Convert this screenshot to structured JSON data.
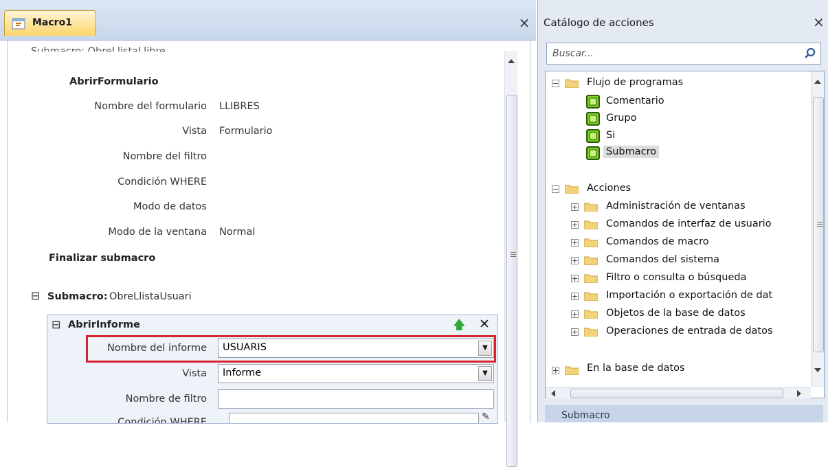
{
  "left": {
    "tab_title": "Macro1",
    "close_glyph": "×",
    "partial_header": "Submacro: ObreLlistaLlibre",
    "open_form": {
      "title": "AbrirFormulario",
      "rows": [
        {
          "label": "Nombre del formulario",
          "value": "LLIBRES"
        },
        {
          "label": "Vista",
          "value": "Formulario"
        },
        {
          "label": "Nombre del filtro",
          "value": ""
        },
        {
          "label": "Condición WHERE",
          "value": ""
        },
        {
          "label": "Modo de datos",
          "value": ""
        },
        {
          "label": "Modo de la ventana",
          "value": "Normal"
        }
      ]
    },
    "end_submacro": "Finalizar submacro",
    "submacro": {
      "collapse": "⊟",
      "keyword": "Submacro:",
      "name": "ObreLlistaUsuari"
    },
    "open_report": {
      "title": "AbrirInforme",
      "collapse": "⊟",
      "report_name_label": "Nombre del informe",
      "report_name_value": "USUARIS",
      "view_label": "Vista",
      "view_value": "Informe",
      "filter_label": "Nombre de filtro",
      "filter_value": "",
      "where_label": "Condición WHERE",
      "where_value": ""
    },
    "move_up_glyph": "🡅",
    "delete_glyph": "✕"
  },
  "catalog": {
    "title": "Catálogo de acciones",
    "close_glyph": "×",
    "search_placeholder": "Buscar...",
    "flow_group": "Flujo de programas",
    "flow_items": [
      "Comentario",
      "Grupo",
      "Si",
      "Submacro"
    ],
    "actions_group": "Acciones",
    "action_items": [
      "Administración de ventanas",
      "Comandos de interfaz de usuario",
      "Comandos de macro",
      "Comandos del sistema",
      "Filtro o consulta o búsqueda",
      "Importación o exportación de dat",
      "Objetos de la base de datos",
      "Operaciones de entrada de datos"
    ],
    "db_group": "En la base de datos",
    "description_header": "Submacro"
  },
  "colors": {
    "highlight": "#d9232f",
    "tab_active": "#fcd56a",
    "flow_icon": "#7bd21f"
  }
}
